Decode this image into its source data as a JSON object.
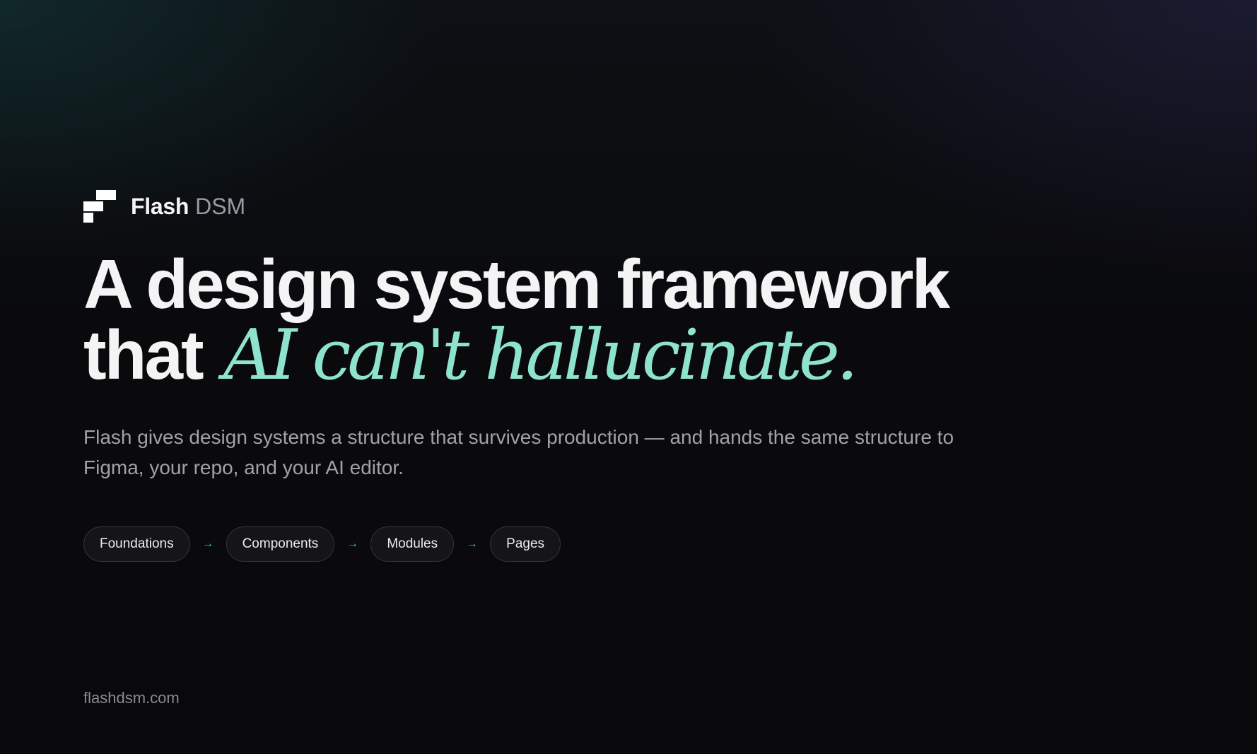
{
  "brand": {
    "name": "Flash",
    "suffix": "DSM",
    "logo_icon": "flash-logo-icon"
  },
  "headline": {
    "line1": "A design system framework",
    "line2_prefix": "that",
    "line2_accent": "AI can't hallucinate."
  },
  "subtitle": "Flash gives design systems a structure that survives production — and hands the same structure to Figma, your repo, and your AI editor.",
  "pipeline": {
    "steps": [
      "Foundations",
      "Components",
      "Modules",
      "Pages"
    ],
    "arrow": "→"
  },
  "footer": {
    "url": "flashdsm.com"
  },
  "colors": {
    "accent": "#8ee3cf",
    "arrow": "#3fcf9e",
    "background": "#0b0b0e",
    "text": "#f4f4f5",
    "muted": "#a1a1aa"
  }
}
